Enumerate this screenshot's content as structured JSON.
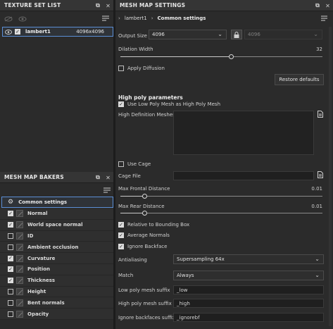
{
  "left_panel": {
    "title": "TEXTURE SET LIST",
    "texture_set": {
      "name": "lambert1",
      "resolution": "4096x4096",
      "checked": true
    }
  },
  "bakers_panel": {
    "title": "MESH MAP BAKERS",
    "common_settings_label": "Common settings",
    "items": [
      {
        "label": "Normal",
        "checked": true
      },
      {
        "label": "World space normal",
        "checked": true
      },
      {
        "label": "ID",
        "checked": false
      },
      {
        "label": "Ambient occlusion",
        "checked": false
      },
      {
        "label": "Curvature",
        "checked": true
      },
      {
        "label": "Position",
        "checked": true
      },
      {
        "label": "Thickness",
        "checked": true
      },
      {
        "label": "Height",
        "checked": false
      },
      {
        "label": "Bent normals",
        "checked": false
      },
      {
        "label": "Opacity",
        "checked": false
      }
    ]
  },
  "right_panel": {
    "title": "MESH MAP SETTINGS",
    "breadcrumb": {
      "set": "lambert1",
      "section": "Common settings"
    },
    "output_size": {
      "label": "Output Size",
      "value": "4096",
      "linked_value": "4096"
    },
    "dilation_width": {
      "label": "Dilation Width",
      "value": "32",
      "fraction": 0.55
    },
    "apply_diffusion": {
      "label": "Apply Diffusion",
      "checked": false
    },
    "restore_defaults_label": "Restore defaults",
    "high_poly": {
      "heading": "High poly parameters",
      "use_low_poly": {
        "label": "Use Low Poly Mesh as High Poly Mesh",
        "checked": true
      },
      "meshes_label": "High Definition Meshes"
    },
    "use_cage": {
      "label": "Use Cage",
      "checked": false
    },
    "cage_file_label": "Cage File",
    "max_frontal": {
      "label": "Max Frontal Distance",
      "value": "0.01",
      "fraction": 0.12
    },
    "max_rear": {
      "label": "Max Rear Distance",
      "value": "0.01",
      "fraction": 0.12
    },
    "relative_bbox": {
      "label": "Relative to Bounding Box",
      "checked": true
    },
    "average_normals": {
      "label": "Average Normals",
      "checked": true
    },
    "ignore_backface": {
      "label": "Ignore Backface",
      "checked": true
    },
    "antialiasing": {
      "label": "Antialiasing",
      "value": "Supersampling 64x"
    },
    "match": {
      "label": "Match",
      "value": "Always"
    },
    "low_poly_suffix": {
      "label": "Low poly mesh suffix",
      "value": "_low"
    },
    "high_poly_suffix": {
      "label": "High poly mesh suffix",
      "value": "_high"
    },
    "ignore_backfaces_suffix": {
      "label": "Ignore backfaces suffix",
      "value": "_ignorebf"
    }
  },
  "icons": {
    "expand": "window-float-icon",
    "close": "close-icon",
    "eye": "eye-icon",
    "gear": "gear-icon",
    "lock": "lock-icon",
    "file": "file-icon",
    "menu": "list-menu-icon"
  },
  "colors": {
    "accent": "#5b8fd6",
    "background": "#2b2b2b",
    "header": "#353535"
  }
}
